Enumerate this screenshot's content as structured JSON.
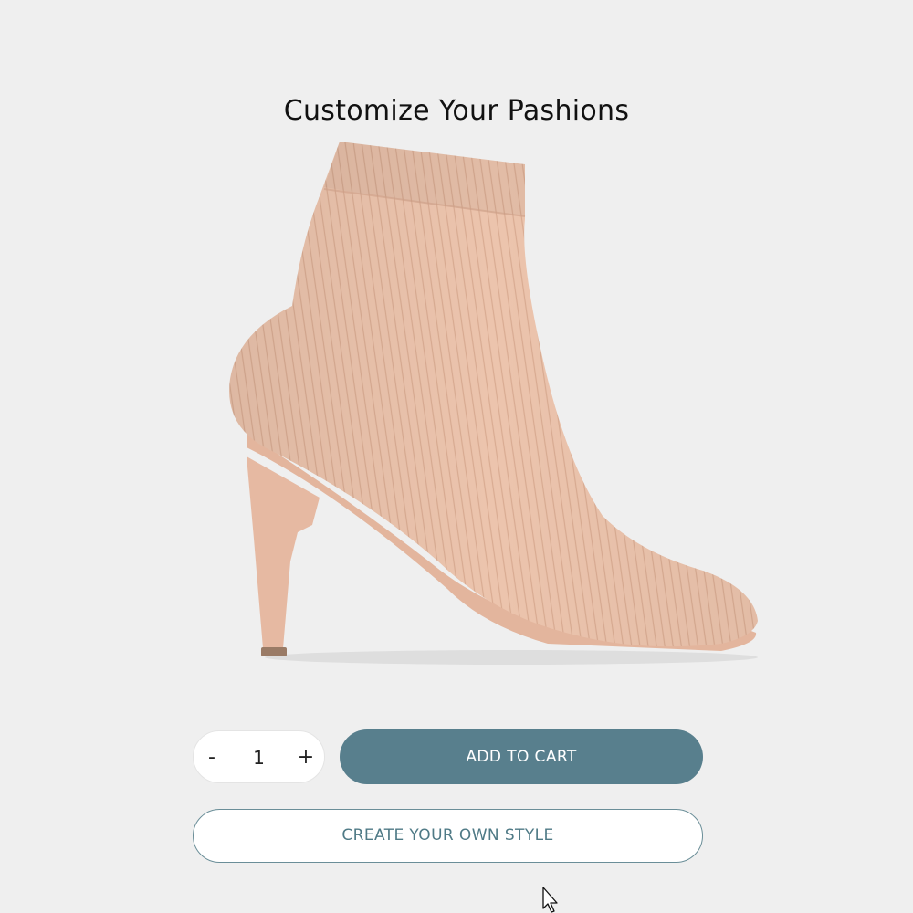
{
  "page": {
    "title": "Customize Your Pashions"
  },
  "product": {
    "image_icon": "ankle-boot-image",
    "color": "#ecc4ad"
  },
  "quantity": {
    "decrement_label": "-",
    "value": "1",
    "increment_label": "+"
  },
  "actions": {
    "add_to_cart_label": "ADD TO CART",
    "create_style_label": "CREATE YOUR OWN STYLE"
  },
  "colors": {
    "accent": "#587f8d",
    "background": "#efefef"
  }
}
